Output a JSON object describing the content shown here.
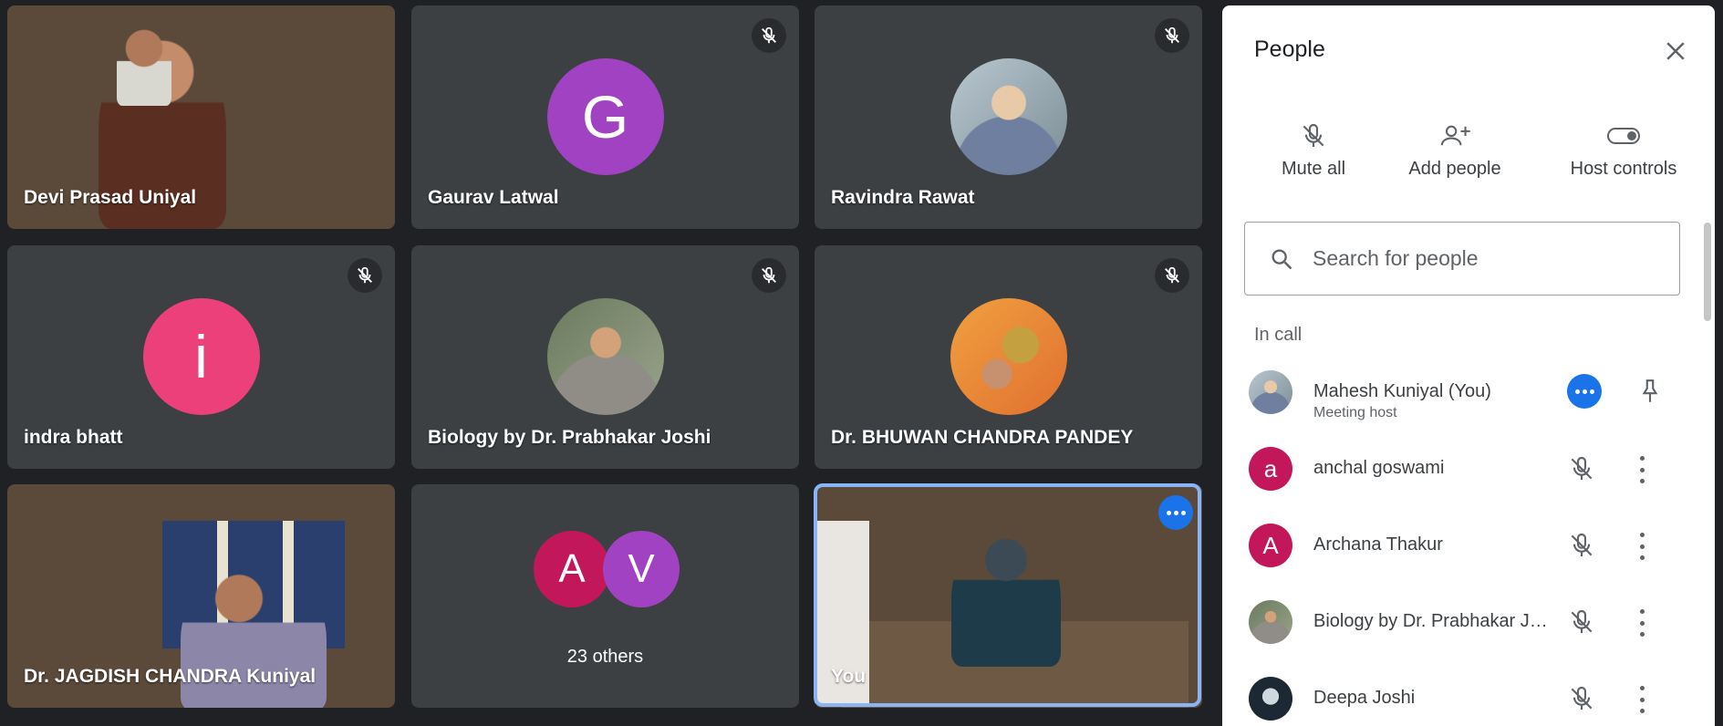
{
  "tiles": [
    {
      "name": "Devi Prasad Uniyal"
    },
    {
      "name": "Gaurav Latwal",
      "initial": "G"
    },
    {
      "name": "Ravindra Rawat"
    },
    {
      "name": "indra bhatt",
      "initial": "i"
    },
    {
      "name": "Biology by Dr. Prabhakar Joshi"
    },
    {
      "name": "Dr. BHUWAN CHANDRA PANDEY"
    },
    {
      "name": "Dr. JAGDISH CHANDRA Kuniyal"
    },
    {
      "others_label": "23 others",
      "avatar1": "A",
      "avatar2": "V"
    },
    {
      "name": "You"
    }
  ],
  "panel": {
    "title": "People",
    "actions": {
      "mute_all": "Mute all",
      "add_people": "Add people",
      "host_controls": "Host controls"
    },
    "search_placeholder": "Search for people",
    "section": "In call",
    "participants": [
      {
        "name": "Mahesh Kuniyal (You)",
        "role": "Meeting host"
      },
      {
        "name": "anchal goswami",
        "initial": "a"
      },
      {
        "name": "Archana Thakur",
        "initial": "A"
      },
      {
        "name": "Biology by Dr. Prabhakar Joshi"
      },
      {
        "name": "Deepa Joshi"
      }
    ]
  },
  "colors": {
    "purple": "#a142c2",
    "pink": "#ec407a",
    "crimson": "#c2185b",
    "blue": "#1a73e8",
    "highlight": "#8ab4f8"
  }
}
